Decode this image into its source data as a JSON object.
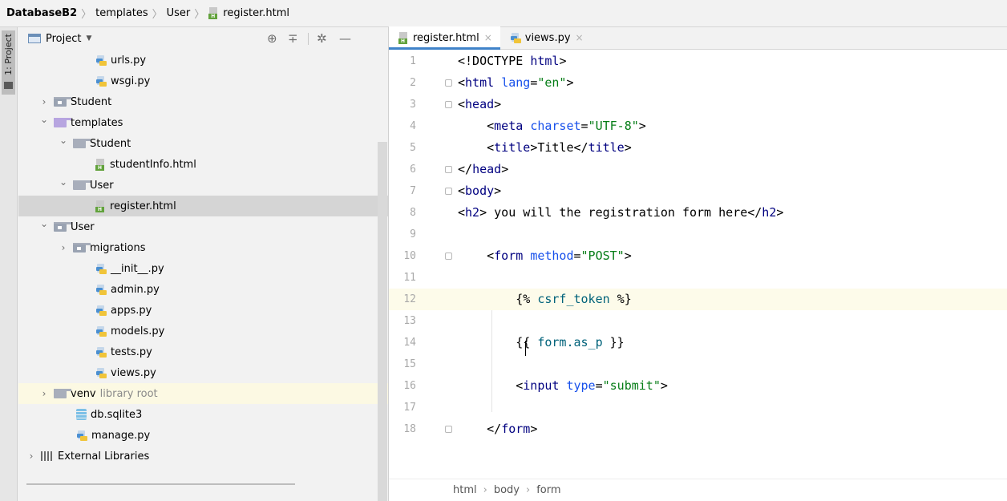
{
  "breadcrumb": [
    "DatabaseB2",
    "templates",
    "User",
    "register.html"
  ],
  "sidebar_strip": {
    "label": "1: Project"
  },
  "project_panel": {
    "title": "Project",
    "header_icons": [
      "target-icon",
      "collapse-all-icon",
      "gear-icon",
      "minimize-icon"
    ]
  },
  "tree": [
    {
      "label": "urls.py",
      "icon": "python-file-icon",
      "depth": 3
    },
    {
      "label": "wsgi.py",
      "icon": "python-file-icon",
      "depth": 3
    },
    {
      "label": "Student",
      "icon": "package-folder-icon",
      "depth": 1,
      "expanded": false
    },
    {
      "label": "templates",
      "icon": "templates-folder-icon",
      "depth": 1,
      "expanded": true
    },
    {
      "label": "Student",
      "icon": "folder-icon",
      "depth": 2,
      "expanded": true
    },
    {
      "label": "studentInfo.html",
      "icon": "html-file-icon",
      "depth": 3
    },
    {
      "label": "User",
      "icon": "folder-icon",
      "depth": 2,
      "expanded": true
    },
    {
      "label": "register.html",
      "icon": "html-file-icon",
      "depth": 3,
      "selected": true
    },
    {
      "label": "User",
      "icon": "package-folder-icon",
      "depth": 1,
      "expanded": true
    },
    {
      "label": "migrations",
      "icon": "package-folder-icon",
      "depth": 2,
      "expanded": false
    },
    {
      "label": "__init__.py",
      "icon": "python-file-icon",
      "depth": 3
    },
    {
      "label": "admin.py",
      "icon": "python-file-icon",
      "depth": 3
    },
    {
      "label": "apps.py",
      "icon": "python-file-icon",
      "depth": 3
    },
    {
      "label": "models.py",
      "icon": "python-file-icon",
      "depth": 3
    },
    {
      "label": "tests.py",
      "icon": "python-file-icon",
      "depth": 3
    },
    {
      "label": "views.py",
      "icon": "python-file-icon",
      "depth": 3
    },
    {
      "label": "venv",
      "suffix": "library root",
      "icon": "folder-icon",
      "depth": 1,
      "expanded": false,
      "highlight": true
    },
    {
      "label": "db.sqlite3",
      "icon": "database-icon",
      "depth": 2
    },
    {
      "label": "manage.py",
      "icon": "python-file-icon",
      "depth": 2
    },
    {
      "label": "External Libraries",
      "icon": "library-icon",
      "depth": 0,
      "expanded": false
    }
  ],
  "editor": {
    "tabs": [
      {
        "label": "register.html",
        "icon": "html-file-icon",
        "active": true
      },
      {
        "label": "views.py",
        "icon": "python-file-icon",
        "active": false
      }
    ],
    "current_line": 12,
    "lines": [
      {
        "n": "1",
        "text": "<!DOCTYPE html>"
      },
      {
        "n": "2",
        "text": "<html lang=\"en\">"
      },
      {
        "n": "3",
        "text": "<head>"
      },
      {
        "n": "4",
        "text": "    <meta charset=\"UTF-8\">"
      },
      {
        "n": "5",
        "text": "    <title>Title</title>"
      },
      {
        "n": "6",
        "text": "</head>"
      },
      {
        "n": "7",
        "text": "<body>"
      },
      {
        "n": "8",
        "text": "<h2> you will the registration form here</h2>"
      },
      {
        "n": "9",
        "text": ""
      },
      {
        "n": "10",
        "text": "    <form method=\"POST\">"
      },
      {
        "n": "11",
        "text": ""
      },
      {
        "n": "12",
        "text": "        {% csrf_token %}"
      },
      {
        "n": "13",
        "text": ""
      },
      {
        "n": "14",
        "text": "        {{ form.as_p }}"
      },
      {
        "n": "15",
        "text": ""
      },
      {
        "n": "16",
        "text": "        <input type=\"submit\">"
      },
      {
        "n": "17",
        "text": ""
      },
      {
        "n": "18",
        "text": "    </form>"
      }
    ],
    "status_path": [
      "html",
      "body",
      "form"
    ]
  },
  "colors": {
    "tag": "#000080",
    "attribute": "#1750eb",
    "string": "#067d17",
    "template": "#00627a",
    "selection": "#d5d5d5",
    "current_line": "#fdfbea",
    "tab_underline": "#4083c9"
  }
}
